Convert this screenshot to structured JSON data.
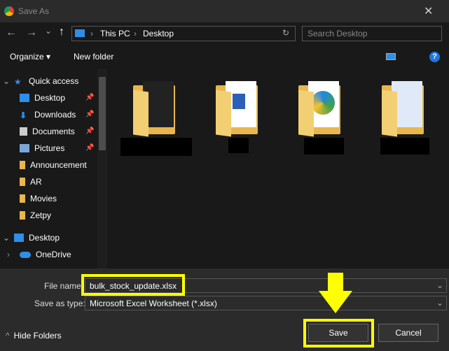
{
  "window": {
    "title": "Save As",
    "close": "✕"
  },
  "nav": {
    "back": "←",
    "forward": "→",
    "recent": "⌄",
    "up": "↑",
    "breadcrumb": [
      "This PC",
      "Desktop"
    ],
    "refresh": "↻",
    "search_placeholder": "Search Desktop"
  },
  "toolbar": {
    "organize": "Organize ▾",
    "new_folder": "New folder",
    "help": "?"
  },
  "sidebar": {
    "items": [
      {
        "label": "Quick access",
        "icon": "star-icon",
        "color": "#3b8eea"
      },
      {
        "label": "Desktop",
        "icon": "desktop-icon",
        "pinned": true,
        "color": "#2f8ee8"
      },
      {
        "label": "Downloads",
        "icon": "download-icon",
        "pinned": true,
        "color": "#2f8ee8"
      },
      {
        "label": "Documents",
        "icon": "documents-icon",
        "pinned": true,
        "color": "#cccccc"
      },
      {
        "label": "Pictures",
        "icon": "pictures-icon",
        "pinned": true,
        "color": "#7aa7d8"
      },
      {
        "label": "Announcement",
        "icon": "folder-icon",
        "color": "#e8b64c"
      },
      {
        "label": "AR",
        "icon": "folder-icon",
        "color": "#e8b64c"
      },
      {
        "label": "Movies",
        "icon": "folder-icon",
        "color": "#e8b64c"
      },
      {
        "label": "Zetpy",
        "icon": "folder-icon",
        "color": "#e8b64c"
      },
      {
        "label": "Desktop",
        "icon": "desktop-icon",
        "color": "#2f8ee8"
      },
      {
        "label": "OneDrive",
        "icon": "cloud-icon",
        "color": "#2f8ee8"
      }
    ]
  },
  "form": {
    "file_name_label": "File name:",
    "file_name": "bulk_stock_update.xlsx",
    "type_label": "Save as type:",
    "type_value": "Microsoft Excel Worksheet (*.xlsx)"
  },
  "buttons": {
    "hide_folders": "Hide Folders",
    "save": "Save",
    "cancel": "Cancel"
  },
  "colors": {
    "highlight": "#ffff00",
    "accent": "#1e90ff"
  }
}
